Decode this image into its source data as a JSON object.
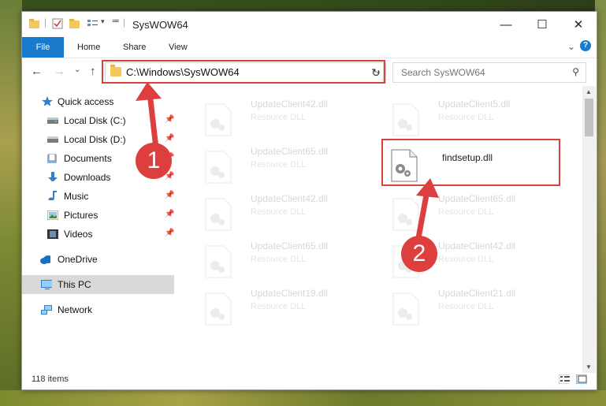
{
  "window": {
    "title": "SysWOW64",
    "minimize_glyph": "—",
    "maximize_glyph": "☐",
    "close_glyph": "✕"
  },
  "ribbon": {
    "tabs": [
      "File",
      "Home",
      "Share",
      "View"
    ],
    "collapse_glyph": "⌄",
    "help_glyph": "?"
  },
  "address": {
    "path": "C:\\Windows\\SysWOW64",
    "dropdown_glyph": "⌄",
    "refresh_glyph": "↻",
    "back_glyph": "←",
    "forward_glyph": "→",
    "recent_glyph": "⌄",
    "up_glyph": "↑"
  },
  "search": {
    "placeholder": "Search SysWOW64",
    "icon_glyph": "⚲"
  },
  "navigation": {
    "pin_glyph": "📌",
    "items": [
      {
        "label": "Quick access",
        "icon": "star-icon",
        "pinned": false
      },
      {
        "label": "Local Disk (C:)",
        "icon": "drive-icon",
        "pinned": true
      },
      {
        "label": "Local Disk (D:)",
        "icon": "drive-icon",
        "pinned": true
      },
      {
        "label": "Documents",
        "icon": "documents-icon",
        "pinned": true
      },
      {
        "label": "Downloads",
        "icon": "downloads-icon",
        "pinned": true
      },
      {
        "label": "Music",
        "icon": "music-icon",
        "pinned": true
      },
      {
        "label": "Pictures",
        "icon": "pictures-icon",
        "pinned": true
      },
      {
        "label": "Videos",
        "icon": "videos-icon",
        "pinned": true
      },
      {
        "label": "OneDrive",
        "icon": "cloud-icon",
        "pinned": false
      },
      {
        "label": "This PC",
        "icon": "computer-icon",
        "pinned": false,
        "selected": true
      },
      {
        "label": "Network",
        "icon": "network-icon",
        "pinned": false
      }
    ]
  },
  "files": [
    {
      "name": "UpdateClient42.dll",
      "type": "Resource DLL",
      "highlighted": false
    },
    {
      "name": "UpdateClient5.dll",
      "type": "Resource DLL",
      "highlighted": false
    },
    {
      "name": "UpdateClient65.dll",
      "type": "Resource DLL",
      "highlighted": false
    },
    {
      "name": "findsetup.dll",
      "type": "",
      "highlighted": true
    },
    {
      "name": "UpdateClient42.dll",
      "type": "Resource DLL",
      "highlighted": false
    },
    {
      "name": "UpdateClient65.dll",
      "type": "Resource DLL",
      "highlighted": false
    },
    {
      "name": "UpdateClient65.dll",
      "type": "Resource DLL",
      "highlighted": false
    },
    {
      "name": "UpdateClient42.dll",
      "type": "Resource DLL",
      "highlighted": false
    },
    {
      "name": "UpdateClient19.dll",
      "type": "Resource DLL",
      "highlighted": false
    },
    {
      "name": "UpdateClient21.dll",
      "type": "Resource DLL",
      "highlighted": false
    }
  ],
  "status": {
    "item_count": "118 items"
  },
  "annotations": [
    {
      "number": "1",
      "color": "#dc3f3d"
    },
    {
      "number": "2",
      "color": "#dc3f3d"
    }
  ]
}
